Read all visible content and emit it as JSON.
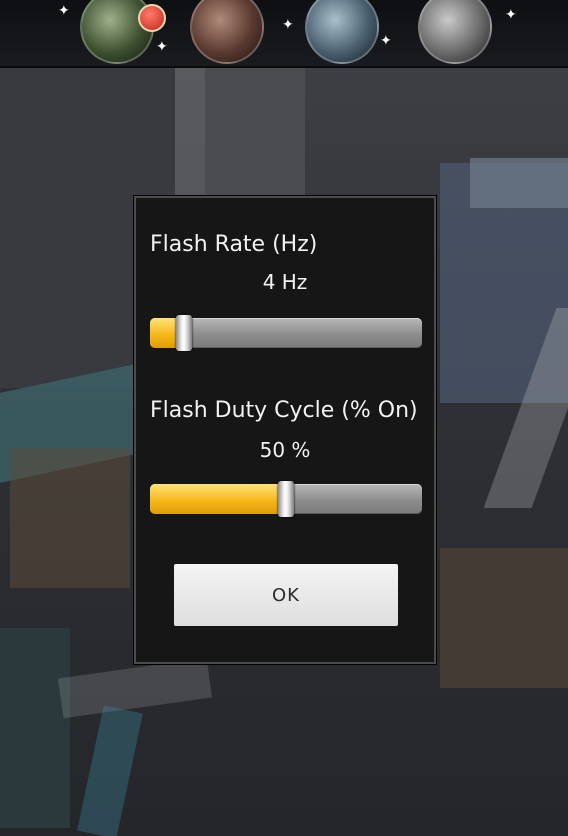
{
  "dialog": {
    "flash_rate": {
      "label": "Flash Rate (Hz)",
      "value_text": "4 Hz",
      "slider_fraction": 0.125
    },
    "duty_cycle": {
      "label": "Flash Duty Cycle (% On)",
      "value_text": "50 %",
      "slider_fraction": 0.5
    },
    "ok_label": "OK"
  },
  "colors": {
    "slider_fill": "#f6b81b",
    "slider_track": "#8d8d8d",
    "dialog_bg": "#161616"
  }
}
